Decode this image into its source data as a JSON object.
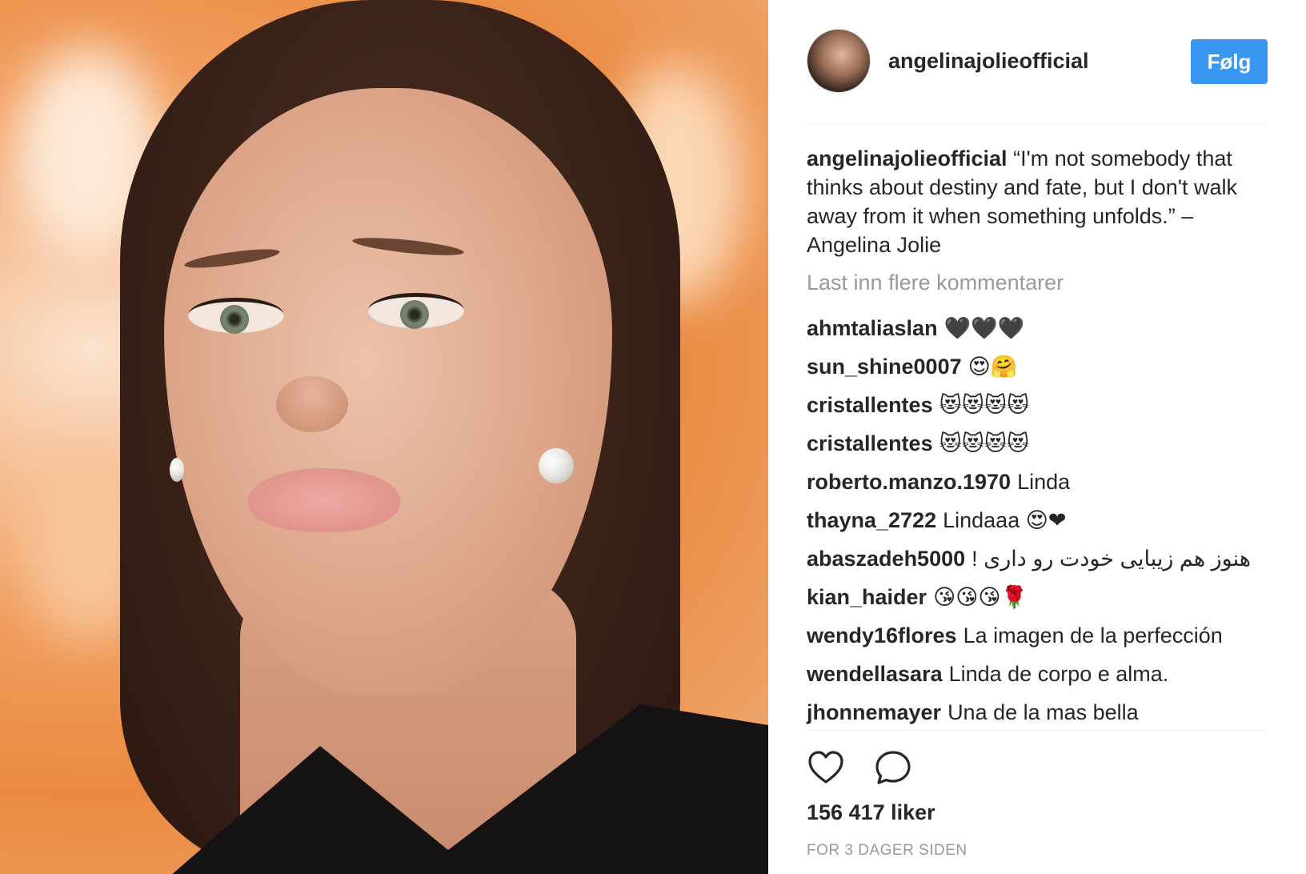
{
  "header": {
    "username": "angelinajolieofficial",
    "follow_label": "Følg"
  },
  "caption": {
    "username": "angelinajolieofficial",
    "text": "“I'm not somebody that thinks about destiny and fate, but I don't walk away from it when something unfolds.” – Angelina Jolie"
  },
  "load_more_label": "Last inn flere kommentarer",
  "comments": [
    {
      "username": "ahmtaliaslan",
      "text": "🖤🖤🖤"
    },
    {
      "username": "sun_shine0007",
      "text": "😍🤗"
    },
    {
      "username": "cristallentes",
      "text": "😻😻😻😻"
    },
    {
      "username": "cristallentes",
      "text": "😻😻😻😻"
    },
    {
      "username": "roberto.manzo.1970",
      "text": "Linda"
    },
    {
      "username": "thayna_2722",
      "text": "Lindaaa 😍❤"
    },
    {
      "username": "abaszadeh5000",
      "text": "هنوز هم زیبایی خودت رو داری !"
    },
    {
      "username": "kian_haider",
      "text": "😘😘😘🌹"
    },
    {
      "username": "wendy16flores",
      "text": "La imagen de la perfección"
    },
    {
      "username": "wendellasara",
      "text": "Linda de corpo e alma."
    },
    {
      "username": "jhonnemayer",
      "text": "Una de la mas bella"
    }
  ],
  "actions": {
    "like_icon": "heart-outline-icon",
    "comment_icon": "speech-bubble-icon"
  },
  "likes_text": "156 417 liker",
  "timestamp": "FOR 3 DAGER SIDEN",
  "colors": {
    "accent": "#3897f0",
    "muted_text": "#999999",
    "text": "#262626",
    "divider": "#efefef"
  }
}
